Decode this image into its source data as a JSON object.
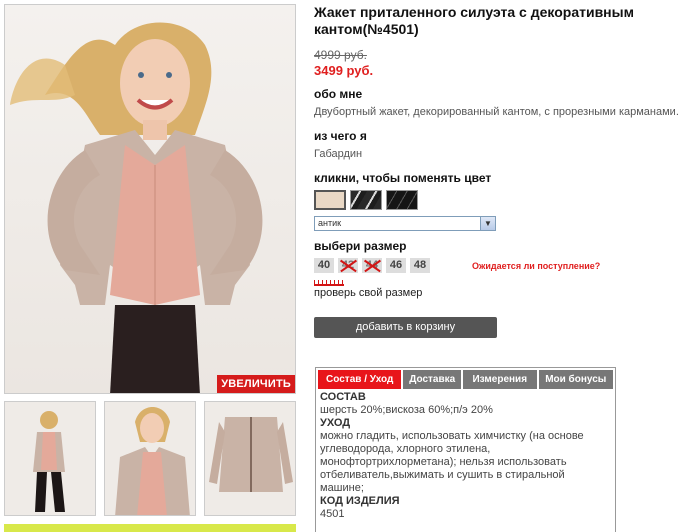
{
  "gallery": {
    "zoom_label": "УВЕЛИЧИТЬ"
  },
  "product": {
    "title_line1": "Жакет приталенного силуэта с декоративным",
    "title_line2": "кантом(№4501)",
    "old_price": "4999 руб.",
    "new_price": "3499 руб.",
    "about_heading": "обо мне",
    "about_text": "Двубортный жакет, декорированный кантом, с прорезными карманами.",
    "material_heading": "из чего я",
    "material_text": "Габардин",
    "color_heading": "кликни, чтобы поменять цвет",
    "color_select_value": "антик",
    "size_heading": "выбери размер",
    "sizes": [
      "40",
      "42",
      "44",
      "46",
      "48"
    ],
    "waiting_link": "Ожидается ли поступление?",
    "check_size_link": "проверь свой размер",
    "add_to_cart": "добавить в корзину",
    "colors": {
      "price_red": "#e01f1f",
      "accent_red": "#e8151a",
      "tab_gray": "#777777",
      "button_gray": "#555555"
    }
  },
  "tabs": {
    "items": [
      "Состав / Уход",
      "Доставка",
      "Измерения",
      "Мои бонусы"
    ],
    "composition_heading": "СОСТАВ",
    "composition_text": "шерсть 20%;вискоза 60%;п/э 20%",
    "care_heading": "УХОД",
    "care_line1": "можно гладить, использовать химчистку (на основе",
    "care_line2": "углеводорода, хлорного этилена,",
    "care_line3": "монофтортрихлорметана); нельзя использовать",
    "care_line4": "отбеливатель,выжимать и сушить в стиральной",
    "care_line5": "машине;",
    "code_heading": "КОД ИЗДЕЛИЯ",
    "code_value": "4501"
  }
}
